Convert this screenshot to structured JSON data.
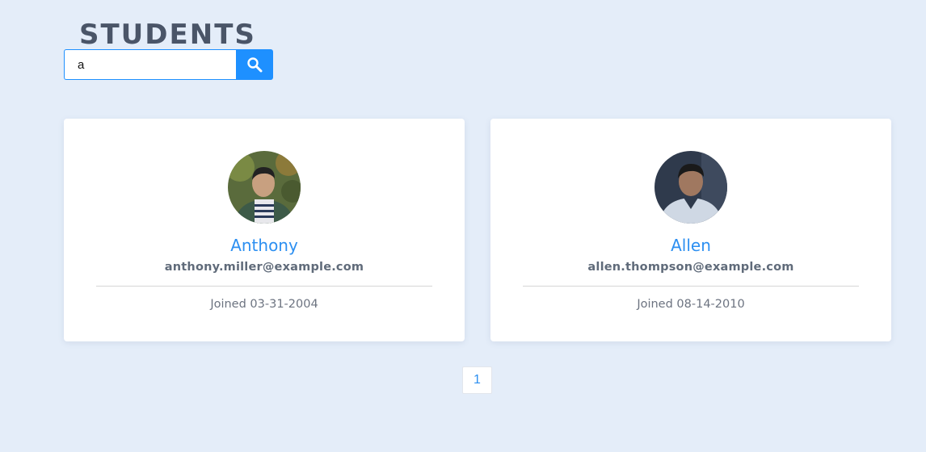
{
  "header": {
    "title": "STUDENTS"
  },
  "search": {
    "value": "a",
    "button_icon": "search-icon"
  },
  "students": [
    {
      "name": "Anthony",
      "email": "anthony.miller@example.com",
      "joined": "Joined 03-31-2004"
    },
    {
      "name": "Allen",
      "email": "allen.thompson@example.com",
      "joined": "Joined 08-14-2010"
    }
  ],
  "pagination": {
    "current_page": "1"
  },
  "colors": {
    "background": "#e4edf9",
    "accent": "#1e90ff",
    "name_text": "#2c8ff1",
    "title_text": "#4a5568"
  }
}
